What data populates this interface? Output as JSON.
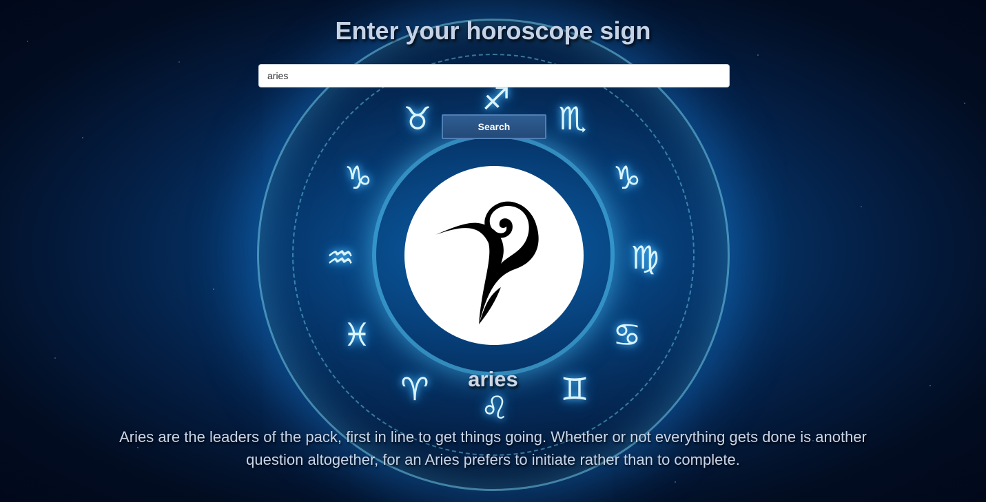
{
  "header": {
    "title": "Enter your horoscope sign"
  },
  "search": {
    "value": "aries",
    "button_label": "Search"
  },
  "zodiac_wheel": {
    "glyphs": [
      "♐",
      "♏",
      "♑",
      "♍",
      "♋",
      "♊",
      "♌",
      "♈",
      "♓",
      "♒",
      "♑",
      "♉"
    ],
    "glow_color": "#4fc3ff"
  },
  "result": {
    "sign_name": "aries",
    "icon": "aries-ram-icon",
    "description": "Aries are the leaders of the pack, first in line to get things going. Whether or not everything gets done is another question altogether, for an Aries prefers to initiate rather than to complete."
  },
  "colors": {
    "background": "#041f45",
    "button": "#2f5d92",
    "text": "#c6d3e6"
  }
}
